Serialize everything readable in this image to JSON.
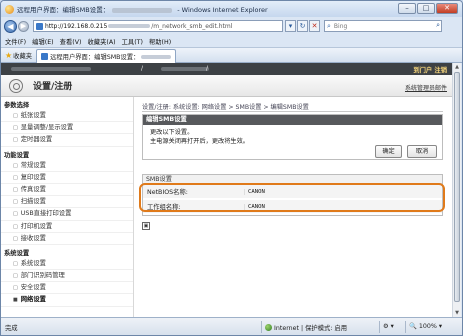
{
  "window": {
    "title_prefix": "远程用户界面：编辑SMB设置：",
    "title_suffix": " - Windows Internet Explorer",
    "controls": [
      "–",
      "□",
      "✕"
    ]
  },
  "address_bar": {
    "host": "http://192.168.0.215",
    "path": "/m_network_smb_edit.html",
    "search_placeholder": "Bing"
  },
  "menu": [
    "文件(F)",
    "编辑(E)",
    "查看(V)",
    "收藏夹(A)",
    "工具(T)",
    "帮助(H)"
  ],
  "favorites": {
    "label": "收藏夹",
    "tab_label": "远程用户界面：编辑SMB设置："
  },
  "topbar": {
    "separator": "/",
    "logout": "到门户 注销"
  },
  "header": {
    "title": "设置/注册",
    "admin_link": "系统管理员邮件"
  },
  "sidebar": {
    "sections": [
      {
        "title": "参数选择",
        "items": [
          "纸张设置",
          "显量调整/显示设置",
          "定时器设置"
        ]
      },
      {
        "title": "功能设置",
        "items": [
          "常规设置",
          "复印设置",
          "传真设置",
          "扫描设置",
          "USB直接打印设置",
          "打印机设置",
          "接收设置"
        ]
      },
      {
        "title": "系统设置",
        "items": [
          "系统设置",
          "部门识别码管理",
          "安全设置",
          "网络设置"
        ]
      }
    ],
    "active_item": "网络设置"
  },
  "main": {
    "breadcrumb": "设置/注册: 系统设置: 网络设置 > SMB设置 > 编辑SMB设置",
    "panel_title": "编辑SMB设置",
    "message_line1": "更改以下设置。",
    "message_line2": "主电源关闭再打开后，更改将生效。",
    "ok_button": "确定",
    "cancel_button": "取消",
    "smb_section": "SMB设置",
    "netbios_label": "NetBIOS名称:",
    "netbios_value": "CANON",
    "workgroup_label": "工作组名称:",
    "workgroup_value": "CANON"
  },
  "statusbar": {
    "done": "完成",
    "zone": "Internet | 保护模式: 启用",
    "zoom": "100%"
  }
}
